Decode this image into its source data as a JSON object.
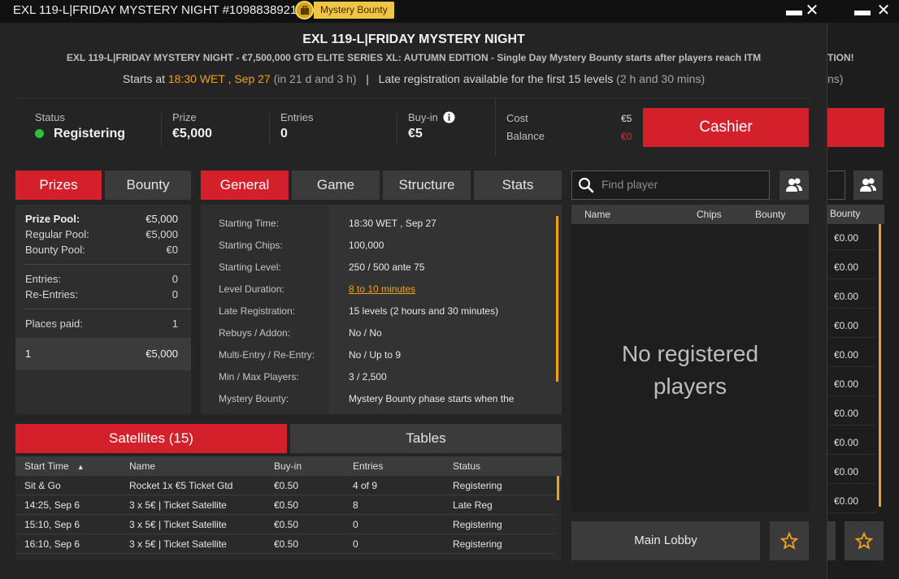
{
  "window": {
    "title": "EXL 119-L|FRIDAY MYSTERY NIGHT #1098838921",
    "badge_label": "Mystery Bounty",
    "minimize_glyph": "▬",
    "close_glyph": "✕"
  },
  "header": {
    "title": "EXL 119-L|FRIDAY MYSTERY NIGHT",
    "subtitle": "EXL 119-L|FRIDAY MYSTERY NIGHT - €7,500,000 GTD ELITE SERIES XL: AUTUMN EDITION - Single Day Mystery Bounty starts after players reach ITM",
    "starts_at_label": "Starts at",
    "starts_at_time": "18:30 WET , Sep 27",
    "starts_in": "(in 21 d and 3 h)",
    "separator": "|",
    "late_reg": "Late registration available for the first 15 levels",
    "late_reg_duration": "(2 h and 30 mins)"
  },
  "info": {
    "status_label": "Status",
    "status_value": "Registering",
    "prize_label": "Prize",
    "prize_value": "€5,000",
    "entries_label": "Entries",
    "entries_value": "0",
    "buyin_label": "Buy-in",
    "buyin_value": "€5",
    "cost_label": "Cost",
    "cost_value": "€5",
    "balance_label": "Balance",
    "balance_value": "€0",
    "cashier_label": "Cashier"
  },
  "colors": {
    "accent": "#d3202a",
    "highlight": "#f0a21c",
    "status_green": "#2fbf3d"
  },
  "prizes_tabs": [
    "Prizes",
    "Bounty"
  ],
  "prizes": {
    "pool_label": "Prize Pool:",
    "pool_value": "€5,000",
    "regular_label": "Regular Pool:",
    "regular_value": "€5,000",
    "bounty_label": "Bounty Pool:",
    "bounty_value": "€0",
    "entries_label": "Entries:",
    "entries_value": "0",
    "reentries_label": "Re-Entries:",
    "reentries_value": "0",
    "places_label": "Places paid:",
    "places_value": "1",
    "rank": "1",
    "rank_prize": "€5,000"
  },
  "info_tabs": [
    "General",
    "Game",
    "Structure",
    "Stats"
  ],
  "general": [
    {
      "label": "Starting Time:",
      "value": "18:30 WET , Sep 27"
    },
    {
      "label": "Starting Chips:",
      "value": "100,000"
    },
    {
      "label": "Starting Level:",
      "value": "250 / 500 ante 75"
    },
    {
      "label": "Level Duration:",
      "value": "8 to 10 minutes"
    },
    {
      "label": "Late Registration:",
      "value": "15 levels (2 hours and 30 minutes)"
    },
    {
      "label": "Rebuys / Addon:",
      "value": "No / No"
    },
    {
      "label": "Multi-Entry / Re-Entry:",
      "value": "No / Up to 9"
    },
    {
      "label": "Min / Max Players:",
      "value": "3 / 2,500"
    },
    {
      "label": "Mystery Bounty:",
      "value": "Mystery Bounty phase starts when the"
    }
  ],
  "players": {
    "search_placeholder": "Find player",
    "columns": [
      "Name",
      "Chips",
      "Bounty"
    ],
    "empty_line1": "No registered",
    "empty_line2": "players"
  },
  "lower_tabs": [
    "Satellites (15)",
    "Tables"
  ],
  "satellites": {
    "columns": [
      "Start Time",
      "Name",
      "Buy-in",
      "Entries",
      "Status"
    ],
    "sort_glyph": "▲",
    "rows": [
      {
        "time": "Sit & Go",
        "name": "Rocket 1x €5 Ticket Gtd",
        "buyin": "€0.50",
        "entries": "4 of 9",
        "status": "Registering"
      },
      {
        "time": "14:25, Sep 6",
        "name": "3 x 5€ | Ticket Satellite",
        "buyin": "€0.50",
        "entries": "8",
        "status": "Late Reg"
      },
      {
        "time": "15:10, Sep 6",
        "name": "3 x 5€ | Ticket Satellite",
        "buyin": "€0.50",
        "entries": "0",
        "status": "Registering"
      },
      {
        "time": "16:10, Sep 6",
        "name": "3 x 5€ | Ticket Satellite",
        "buyin": "€0.50",
        "entries": "0",
        "status": "Registering"
      }
    ]
  },
  "footer": {
    "main_lobby": "Main Lobby"
  },
  "background_window": {
    "subtitle_tail": "TION!",
    "time_tail": "ns)",
    "bounty_header": "Bounty",
    "bounty_values": [
      "€0.00",
      "€0.00",
      "€0.00",
      "€0.00",
      "€0.00",
      "€0.00",
      "€0.00",
      "€0.00",
      "€0.00",
      "€0.00"
    ]
  }
}
